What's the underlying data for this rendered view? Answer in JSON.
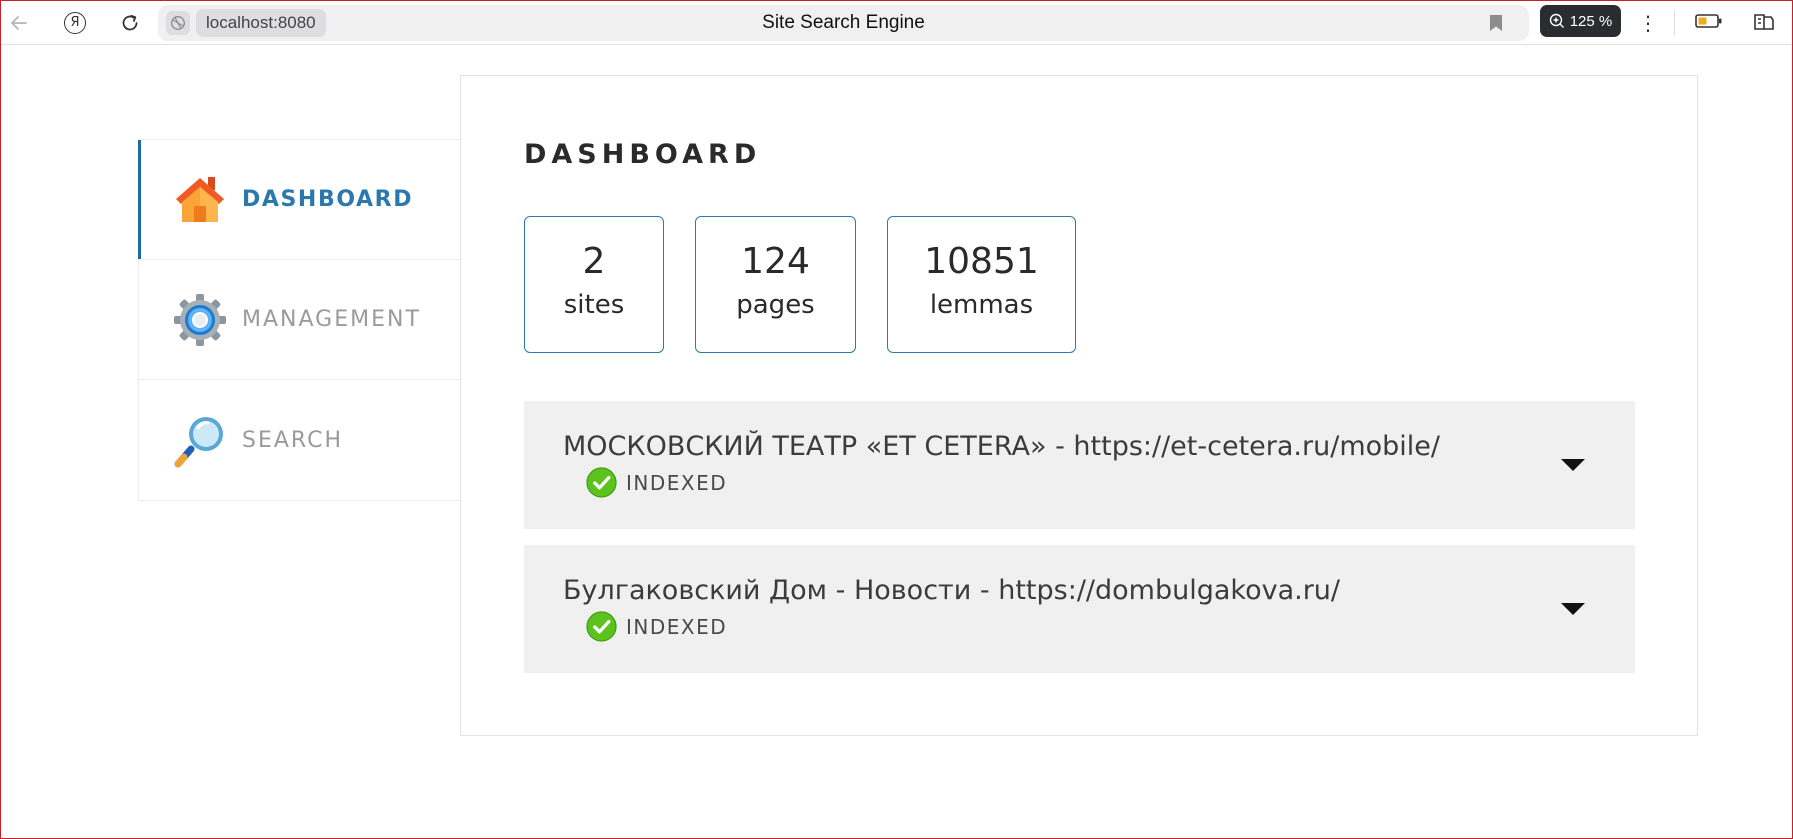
{
  "browser": {
    "url": "localhost:8080",
    "page_title": "Site Search Engine",
    "zoom": "125 %",
    "ya_letter": "Я",
    "more_glyph": "⋮"
  },
  "sidebar": {
    "items": [
      {
        "label": "DASHBOARD",
        "icon": "house-icon",
        "active": true
      },
      {
        "label": "MANAGEMENT",
        "icon": "gear-icon",
        "active": false
      },
      {
        "label": "SEARCH",
        "icon": "magnifier-icon",
        "active": false
      }
    ]
  },
  "dashboard": {
    "title": "DASHBOARD",
    "stats": [
      {
        "value": "2",
        "label": "sites"
      },
      {
        "value": "124",
        "label": "pages"
      },
      {
        "value": "10851",
        "label": "lemmas"
      }
    ],
    "sites": [
      {
        "name": "МОСКОВСКИЙ ТЕАТР «ЕТ СЕТЕRA» - https://et-cetera.ru/mobile/",
        "status": "INDEXED"
      },
      {
        "name": "Булгаковский Дом - Новости - https://dombulgakova.ru/",
        "status": "INDEXED"
      }
    ]
  },
  "colors": {
    "accent": "#2a78ae",
    "stat_border": "#2f77ac",
    "row_background": "#f0f0f0",
    "indexed_check": "#5cc21e"
  }
}
